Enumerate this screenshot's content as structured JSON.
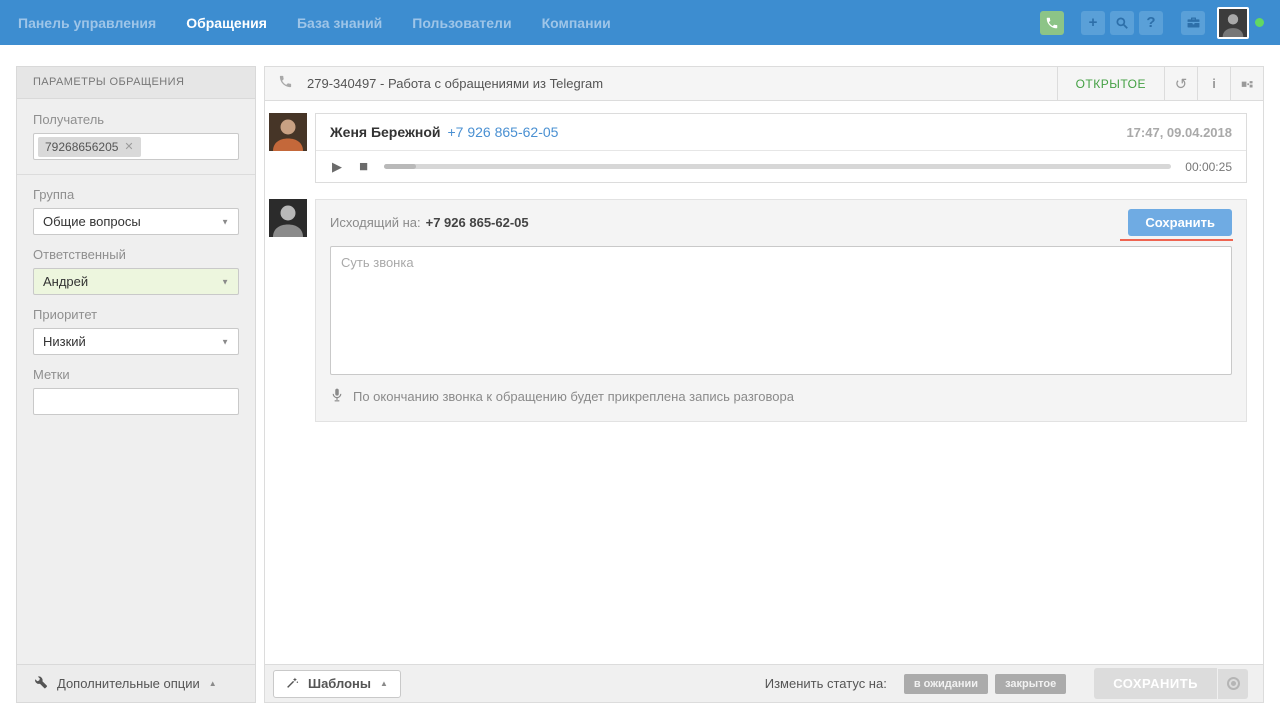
{
  "topnav": {
    "items": [
      {
        "label": "Панель управления"
      },
      {
        "label": "Обращения"
      },
      {
        "label": "База знаний"
      },
      {
        "label": "Пользователи"
      },
      {
        "label": "Компании"
      }
    ]
  },
  "icons": {
    "plus": "+",
    "help": "?",
    "info": "i",
    "history": "↺",
    "play": "▶",
    "stop": "■",
    "dropdown": "▼",
    "collapse": "▲",
    "remove": "✕"
  },
  "sidebar": {
    "title": "ПАРАМЕТРЫ ОБРАЩЕНИЯ",
    "recipient_label": "Получатель",
    "recipient_tag": "79268656205",
    "group_label": "Группа",
    "group_value": "Общие вопросы",
    "assignee_label": "Ответственный",
    "assignee_value": "Андрей",
    "priority_label": "Приоритет",
    "priority_value": "Низкий",
    "tags_label": "Метки",
    "footer_label": "Дополнительные опции"
  },
  "ticket": {
    "title": "279-340497 - Работа с обращениями из Telegram",
    "status": "ОТКРЫТОЕ",
    "call_message": {
      "author": "Женя Бережной",
      "phone": "+7 926 865-62-05",
      "timestamp": "17:47, 09.04.2018",
      "duration": "00:00:25"
    },
    "composer": {
      "direction_label": "Исходящий на:",
      "phone": "+7 926 865-62-05",
      "save_label": "Сохранить",
      "placeholder": "Суть звонка",
      "mic_note": "По окончанию звонка к обращению будет прикреплена запись разговора"
    }
  },
  "footer": {
    "templates_label": "Шаблоны",
    "change_status_label": "Изменить статус на:",
    "status_pending": "в ожидании",
    "status_closed": "закрытое",
    "save_label": "СОХРАНИТЬ"
  },
  "colors": {
    "topbar_blue": "#3d8dd0",
    "phone_button_green": "#8cc487",
    "status_green": "#44a044",
    "link_blue": "#4a90d2",
    "save_blue": "#6fabe3",
    "underline_red": "#ef6450",
    "online_dot_green": "#62d862",
    "assignee_highlight": "#edf6de"
  }
}
